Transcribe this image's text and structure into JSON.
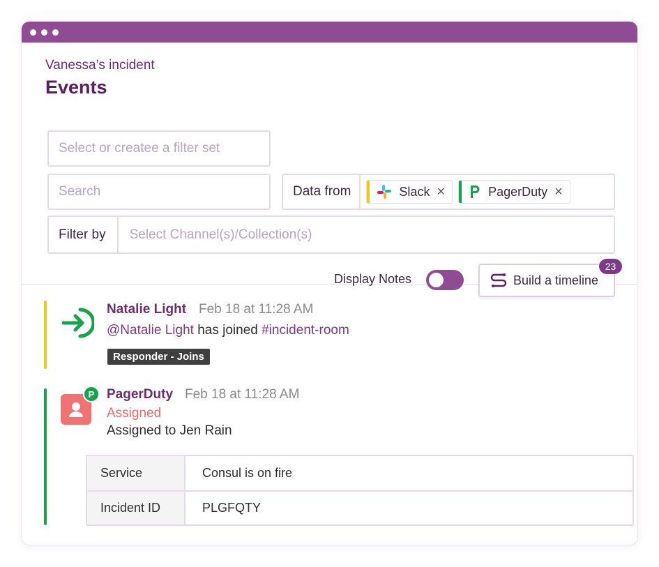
{
  "header": {
    "incident_name": "Vanessa’s incident",
    "page_title": "Events"
  },
  "filters": {
    "filter_set_placeholder": "Select or createe a filter set",
    "search_placeholder": "Search",
    "data_from_label": "Data from",
    "sources": [
      {
        "label": "Slack",
        "icon": "slack-icon",
        "accent": "#f5c518"
      },
      {
        "label": "PagerDuty",
        "icon": "pagerduty-icon",
        "accent": "#16a34a"
      }
    ],
    "remove_glyph": "×",
    "filter_by_label": "Filter by",
    "filter_by_placeholder": "Select Channel(s)/Collection(s)"
  },
  "controls": {
    "display_notes_label": "Display Notes",
    "display_notes_on": true,
    "build_timeline_label": "Build a timeline",
    "timeline_count": "23"
  },
  "events": [
    {
      "author": "Natalie Light",
      "time": "Feb 18 at 11:28 AM",
      "mention": "@Natalie Light",
      "action": " has joined ",
      "channel": "#incident-room",
      "tag": "Responder - Joins",
      "accent": "#f5c518"
    },
    {
      "author": "PagerDuty",
      "time": "Feb 18 at 11:28 AM",
      "status": "Assigned",
      "message": "Assigned to Jen Rain",
      "badge": "P",
      "accent": "#16a34a",
      "details": [
        {
          "key": "Service",
          "value": "Consul is on fire"
        },
        {
          "key": "Incident ID",
          "value": "PLGFQTY"
        }
      ]
    }
  ],
  "colors": {
    "brand": "#8f4b94",
    "title": "#5a1e61",
    "assigned": "#f06a6a"
  }
}
